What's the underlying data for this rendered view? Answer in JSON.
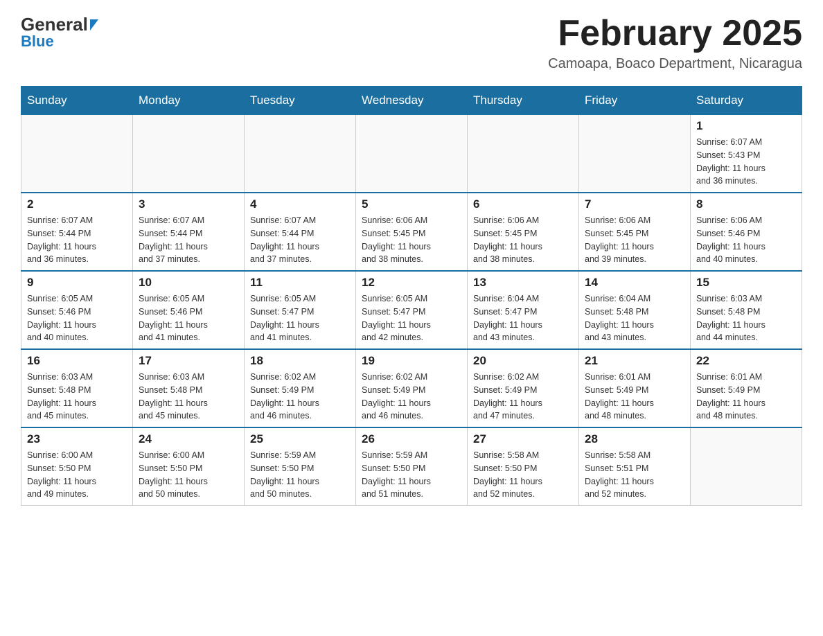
{
  "header": {
    "logo_name1": "General",
    "logo_name2": "Blue",
    "month_title": "February 2025",
    "location": "Camoapa, Boaco Department, Nicaragua"
  },
  "days_of_week": [
    "Sunday",
    "Monday",
    "Tuesday",
    "Wednesday",
    "Thursday",
    "Friday",
    "Saturday"
  ],
  "weeks": [
    [
      {
        "day": "",
        "info": ""
      },
      {
        "day": "",
        "info": ""
      },
      {
        "day": "",
        "info": ""
      },
      {
        "day": "",
        "info": ""
      },
      {
        "day": "",
        "info": ""
      },
      {
        "day": "",
        "info": ""
      },
      {
        "day": "1",
        "info": "Sunrise: 6:07 AM\nSunset: 5:43 PM\nDaylight: 11 hours\nand 36 minutes."
      }
    ],
    [
      {
        "day": "2",
        "info": "Sunrise: 6:07 AM\nSunset: 5:44 PM\nDaylight: 11 hours\nand 36 minutes."
      },
      {
        "day": "3",
        "info": "Sunrise: 6:07 AM\nSunset: 5:44 PM\nDaylight: 11 hours\nand 37 minutes."
      },
      {
        "day": "4",
        "info": "Sunrise: 6:07 AM\nSunset: 5:44 PM\nDaylight: 11 hours\nand 37 minutes."
      },
      {
        "day": "5",
        "info": "Sunrise: 6:06 AM\nSunset: 5:45 PM\nDaylight: 11 hours\nand 38 minutes."
      },
      {
        "day": "6",
        "info": "Sunrise: 6:06 AM\nSunset: 5:45 PM\nDaylight: 11 hours\nand 38 minutes."
      },
      {
        "day": "7",
        "info": "Sunrise: 6:06 AM\nSunset: 5:45 PM\nDaylight: 11 hours\nand 39 minutes."
      },
      {
        "day": "8",
        "info": "Sunrise: 6:06 AM\nSunset: 5:46 PM\nDaylight: 11 hours\nand 40 minutes."
      }
    ],
    [
      {
        "day": "9",
        "info": "Sunrise: 6:05 AM\nSunset: 5:46 PM\nDaylight: 11 hours\nand 40 minutes."
      },
      {
        "day": "10",
        "info": "Sunrise: 6:05 AM\nSunset: 5:46 PM\nDaylight: 11 hours\nand 41 minutes."
      },
      {
        "day": "11",
        "info": "Sunrise: 6:05 AM\nSunset: 5:47 PM\nDaylight: 11 hours\nand 41 minutes."
      },
      {
        "day": "12",
        "info": "Sunrise: 6:05 AM\nSunset: 5:47 PM\nDaylight: 11 hours\nand 42 minutes."
      },
      {
        "day": "13",
        "info": "Sunrise: 6:04 AM\nSunset: 5:47 PM\nDaylight: 11 hours\nand 43 minutes."
      },
      {
        "day": "14",
        "info": "Sunrise: 6:04 AM\nSunset: 5:48 PM\nDaylight: 11 hours\nand 43 minutes."
      },
      {
        "day": "15",
        "info": "Sunrise: 6:03 AM\nSunset: 5:48 PM\nDaylight: 11 hours\nand 44 minutes."
      }
    ],
    [
      {
        "day": "16",
        "info": "Sunrise: 6:03 AM\nSunset: 5:48 PM\nDaylight: 11 hours\nand 45 minutes."
      },
      {
        "day": "17",
        "info": "Sunrise: 6:03 AM\nSunset: 5:48 PM\nDaylight: 11 hours\nand 45 minutes."
      },
      {
        "day": "18",
        "info": "Sunrise: 6:02 AM\nSunset: 5:49 PM\nDaylight: 11 hours\nand 46 minutes."
      },
      {
        "day": "19",
        "info": "Sunrise: 6:02 AM\nSunset: 5:49 PM\nDaylight: 11 hours\nand 46 minutes."
      },
      {
        "day": "20",
        "info": "Sunrise: 6:02 AM\nSunset: 5:49 PM\nDaylight: 11 hours\nand 47 minutes."
      },
      {
        "day": "21",
        "info": "Sunrise: 6:01 AM\nSunset: 5:49 PM\nDaylight: 11 hours\nand 48 minutes."
      },
      {
        "day": "22",
        "info": "Sunrise: 6:01 AM\nSunset: 5:49 PM\nDaylight: 11 hours\nand 48 minutes."
      }
    ],
    [
      {
        "day": "23",
        "info": "Sunrise: 6:00 AM\nSunset: 5:50 PM\nDaylight: 11 hours\nand 49 minutes."
      },
      {
        "day": "24",
        "info": "Sunrise: 6:00 AM\nSunset: 5:50 PM\nDaylight: 11 hours\nand 50 minutes."
      },
      {
        "day": "25",
        "info": "Sunrise: 5:59 AM\nSunset: 5:50 PM\nDaylight: 11 hours\nand 50 minutes."
      },
      {
        "day": "26",
        "info": "Sunrise: 5:59 AM\nSunset: 5:50 PM\nDaylight: 11 hours\nand 51 minutes."
      },
      {
        "day": "27",
        "info": "Sunrise: 5:58 AM\nSunset: 5:50 PM\nDaylight: 11 hours\nand 52 minutes."
      },
      {
        "day": "28",
        "info": "Sunrise: 5:58 AM\nSunset: 5:51 PM\nDaylight: 11 hours\nand 52 minutes."
      },
      {
        "day": "",
        "info": ""
      }
    ]
  ]
}
